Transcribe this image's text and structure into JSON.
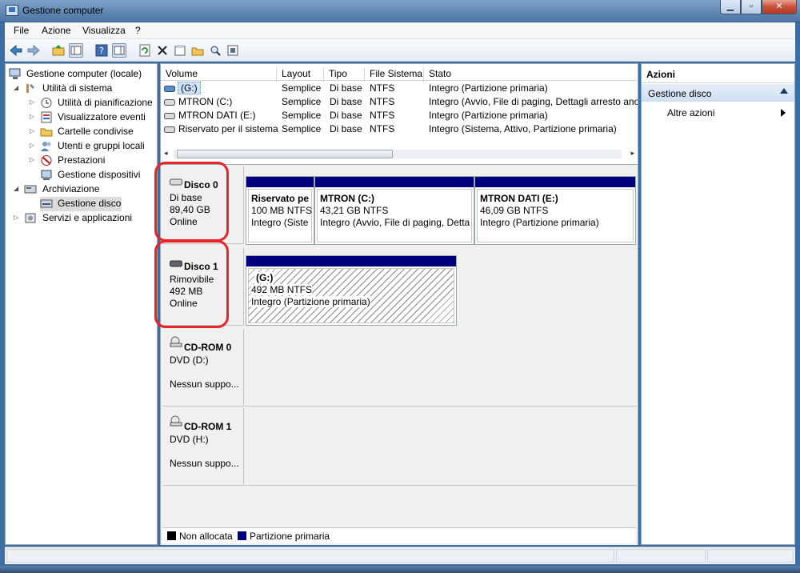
{
  "window": {
    "title": "Gestione computer"
  },
  "menu": {
    "file": "File",
    "azione": "Azione",
    "visualizza": "Visualizza",
    "help": "?"
  },
  "tree": {
    "root": "Gestione computer (locale)",
    "system_tools": "Utilità di sistema",
    "task_scheduler": "Utilità di pianificazione",
    "event_viewer": "Visualizzatore eventi",
    "shared_folders": "Cartelle condivise",
    "local_users": "Utenti e gruppi locali",
    "performance": "Prestazioni",
    "device_manager": "Gestione dispositivi",
    "storage": "Archiviazione",
    "disk_management": "Gestione disco",
    "services": "Servizi e applicazioni"
  },
  "volumes": {
    "headers": {
      "volume": "Volume",
      "layout": "Layout",
      "tipo": "Tipo",
      "fs": "File Sistema",
      "stato": "Stato"
    },
    "rows": [
      {
        "volume": "(G:)",
        "layout": "Semplice",
        "tipo": "Di base",
        "fs": "NTFS",
        "stato": "Integro (Partizione primaria)"
      },
      {
        "volume": "MTRON (C:)",
        "layout": "Semplice",
        "tipo": "Di base",
        "fs": "NTFS",
        "stato": "Integro (Avvio, File di paging, Dettagli arresto ano"
      },
      {
        "volume": "MTRON DATI (E:)",
        "layout": "Semplice",
        "tipo": "Di base",
        "fs": "NTFS",
        "stato": "Integro (Partizione primaria)"
      },
      {
        "volume": "Riservato per il sistema",
        "layout": "Semplice",
        "tipo": "Di base",
        "fs": "NTFS",
        "stato": "Integro (Sistema, Attivo, Partizione primaria)"
      }
    ]
  },
  "disks": [
    {
      "name": "Disco 0",
      "type": "Di base",
      "size": "89,40 GB",
      "status": "Online",
      "partitions": [
        {
          "name": "Riservato pe",
          "size": "100 MB NTFS",
          "status": "Integro (Siste"
        },
        {
          "name": "MTRON  (C:)",
          "size": "43,21 GB NTFS",
          "status": "Integro (Avvio, File di paging, Detta"
        },
        {
          "name": "MTRON DATI  (E:)",
          "size": "46,09 GB NTFS",
          "status": "Integro (Partizione primaria)"
        }
      ]
    },
    {
      "name": "Disco 1",
      "type": "Rimovibile",
      "size": "492 MB",
      "status": "Online",
      "partitions": [
        {
          "name": "(G:)",
          "size": "492 MB NTFS",
          "status": "Integro (Partizione primaria)"
        }
      ]
    },
    {
      "name": "CD-ROM 0",
      "type": "DVD (D:)",
      "size": "",
      "status": "Nessun suppo..."
    },
    {
      "name": "CD-ROM 1",
      "type": "DVD (H:)",
      "size": "",
      "status": "Nessun suppo..."
    }
  ],
  "legend": {
    "unallocated": "Non allocata",
    "primary": "Partizione primaria",
    "unallocated_color": "#000000",
    "primary_color": "#00007f"
  },
  "actions": {
    "header": "Azioni",
    "section": "Gestione disco",
    "more": "Altre azioni"
  },
  "colors": {
    "partition_bar": "#00007f",
    "highlight": "#e8232a"
  }
}
